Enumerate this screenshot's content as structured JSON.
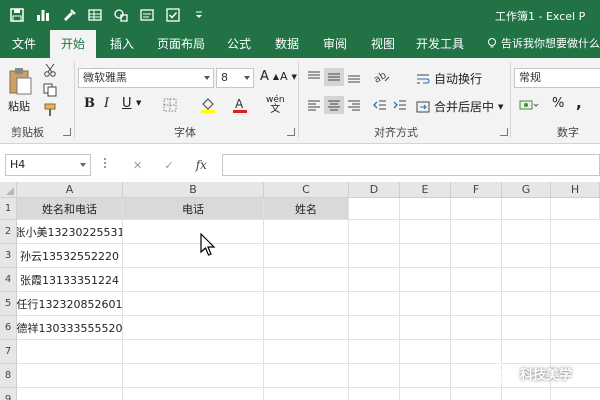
{
  "titlebar": {
    "title": "工作簿1 - Excel P",
    "icons": [
      "save-icon",
      "chart-icon",
      "format-painter-icon",
      "table-icon",
      "shapes-icon",
      "form-icon",
      "checkbox-icon",
      "customize-icon"
    ]
  },
  "tabs": [
    {
      "label": "文件"
    },
    {
      "label": "开始",
      "active": true
    },
    {
      "label": "插入"
    },
    {
      "label": "页面布局"
    },
    {
      "label": "公式"
    },
    {
      "label": "数据"
    },
    {
      "label": "审阅"
    },
    {
      "label": "视图"
    },
    {
      "label": "开发工具"
    }
  ],
  "tell_me": "告诉我你想要做什么",
  "ribbon": {
    "clipboard": {
      "label": "剪贴板",
      "paste_label": "粘贴"
    },
    "font": {
      "label": "字体",
      "font_name": "微软雅黑",
      "font_size": "8",
      "bold": "B",
      "italic": "I",
      "underline": "U",
      "grow": "A",
      "shrink": "A",
      "phonetic": "wén"
    },
    "alignment": {
      "label": "对齐方式",
      "wrap_text": "自动换行",
      "merge_center": "合并后居中"
    },
    "number": {
      "label": "数字",
      "format": "常规",
      "percent": "%",
      "comma": ","
    }
  },
  "formula_bar": {
    "name_box": "H4",
    "cancel": "✕",
    "confirm": "✓",
    "fx": "fx",
    "value": ""
  },
  "sheet": {
    "columns": [
      "A",
      "B",
      "C",
      "D",
      "E",
      "F",
      "G",
      "H"
    ],
    "rows": [
      "1",
      "2",
      "3",
      "4",
      "5",
      "6",
      "7",
      "8",
      "9"
    ],
    "header_row": [
      "姓名和电话",
      "电话",
      "姓名"
    ],
    "data": [
      "张小美13230225531",
      "孙云13532552220",
      "张霞13133351224",
      "任行13232085260​1",
      "德祥130333555520"
    ]
  },
  "watermark": "科技美学",
  "colors": {
    "excel_green": "#217346",
    "ribbon_bg": "#f3f3f3",
    "header_fill": "#d9d9d9"
  }
}
